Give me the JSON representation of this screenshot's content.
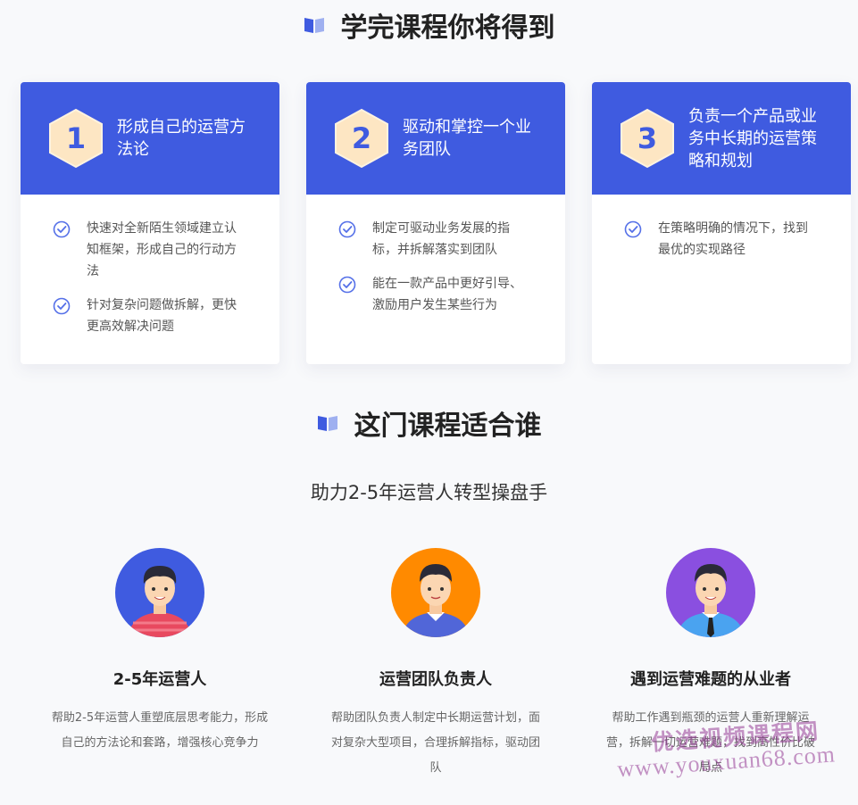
{
  "section1": {
    "title": "学完课程你将得到"
  },
  "cards": [
    {
      "num": "1",
      "title": "形成自己的运营方法论",
      "items": [
        "快速对全新陌生领域建立认知框架，形成自己的行动方法",
        "针对复杂问题做拆解，更快更高效解决问题"
      ]
    },
    {
      "num": "2",
      "title": "驱动和掌控一个业务团队",
      "items": [
        "制定可驱动业务发展的指标，并拆解落实到团队",
        "能在一款产品中更好引导、激励用户发生某些行为"
      ]
    },
    {
      "num": "3",
      "title": "负责一个产品或业务中长期的运营策略和规划",
      "items": [
        "在策略明确的情况下，找到最优的实现路径"
      ]
    }
  ],
  "section2": {
    "title": "这门课程适合谁",
    "subtitle": "助力2-5年运营人转型操盘手"
  },
  "personas": [
    {
      "name": "2-5年运营人",
      "desc": "帮助2-5年运营人重塑底层思考能力，形成自己的方法论和套路，增强核心竞争力",
      "bg": "#3f5be0"
    },
    {
      "name": "运营团队负责人",
      "desc": "帮助团队负责人制定中长期运营计划，面对复杂大型项目，合理拆解指标，驱动团队",
      "bg": "#ff8a00"
    },
    {
      "name": "遇到运营难题的从业者",
      "desc": "帮助工作遇到瓶颈的运营人重新理解运营，拆解一切运营难题，找到高性价比破局点",
      "bg": "#8a4fe0"
    }
  ],
  "watermark": {
    "cn": "优选视频课程网",
    "url": "www.youxuan68.com"
  },
  "colors": {
    "accent": "#3f5be0",
    "hex_fill": "#fde6c3",
    "orange": "#ff8a00",
    "purple": "#8a4fe0"
  }
}
